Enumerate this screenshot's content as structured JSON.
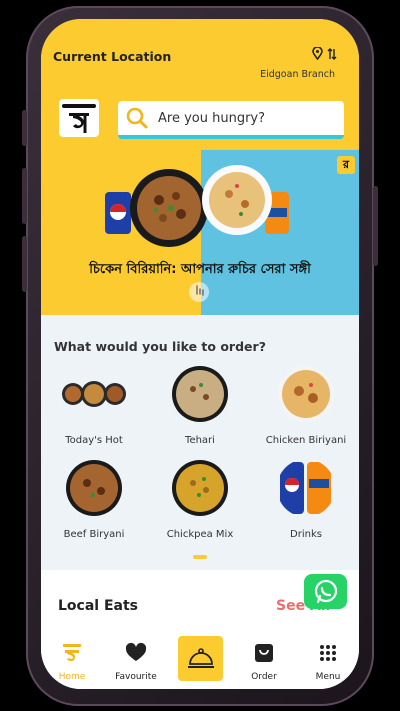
{
  "header": {
    "location_label": "Current Location",
    "branch": "Eidgoan Branch",
    "logo_glyph": "র"
  },
  "search": {
    "placeholder": "Are you hungry?"
  },
  "banner": {
    "title": "চিকেন বিরিয়ানি: আপনার রুচির সেরা সঙ্গী",
    "mini_logo": "র"
  },
  "categories": {
    "title": "What would you like to order?",
    "items": [
      {
        "label": "Today's Hot"
      },
      {
        "label": "Tehari"
      },
      {
        "label": "Chicken Biriyani"
      },
      {
        "label": "Beef Biryani"
      },
      {
        "label": "Chickpea Mix"
      },
      {
        "label": "Drinks"
      }
    ]
  },
  "local_eats": {
    "title": "Local Eats",
    "see_all": "See All"
  },
  "nav": {
    "items": [
      {
        "label": "Home",
        "icon": "home-logo-icon"
      },
      {
        "label": "Favourite",
        "icon": "heart-icon"
      },
      {
        "label": "",
        "icon": "cloche-icon"
      },
      {
        "label": "Order",
        "icon": "bag-icon"
      },
      {
        "label": "Menu",
        "icon": "grid-dots-icon"
      }
    ]
  },
  "colors": {
    "brand_yellow": "#fccb2f",
    "banner_blue": "#5fc2e1",
    "search_underline": "#36c8d8",
    "see_all": "#e86f6f",
    "whatsapp": "#27d367"
  }
}
